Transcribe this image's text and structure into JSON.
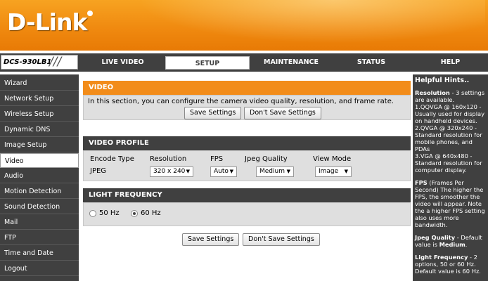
{
  "brand": {
    "logo": "D-Link",
    "model": "DCS-930LB1"
  },
  "tabs": [
    {
      "label": "LIVE VIDEO",
      "selected": false
    },
    {
      "label": "SETUP",
      "selected": true
    },
    {
      "label": "MAINTENANCE",
      "selected": false
    },
    {
      "label": "STATUS",
      "selected": false
    },
    {
      "label": "HELP",
      "selected": false
    }
  ],
  "sidebar": {
    "items": [
      {
        "label": "Wizard"
      },
      {
        "label": "Network Setup"
      },
      {
        "label": "Wireless Setup"
      },
      {
        "label": "Dynamic DNS"
      },
      {
        "label": "Image Setup"
      },
      {
        "label": "Video",
        "active": true
      },
      {
        "label": "Audio"
      },
      {
        "label": "Motion Detection"
      },
      {
        "label": "Sound Detection"
      },
      {
        "label": "Mail"
      },
      {
        "label": "FTP"
      },
      {
        "label": "Time and Date"
      },
      {
        "label": "Logout"
      }
    ]
  },
  "video": {
    "title": "VIDEO",
    "description": "In this section, you can configure the camera video quality, resolution, and frame rate.",
    "save_label": "Save Settings",
    "dont_save_label": "Don't Save Settings"
  },
  "profile": {
    "title": "VIDEO PROFILE",
    "headers": [
      "Encode Type",
      "Resolution",
      "FPS",
      "Jpeg Quality",
      "View Mode"
    ],
    "encode_type": "JPEG",
    "resolution": "320 x 240",
    "fps": "Auto",
    "jpeg_quality": "Medium",
    "view_mode": "Image"
  },
  "light": {
    "title": "LIGHT FREQUENCY",
    "opt_50": "50 Hz",
    "opt_60": "60 Hz",
    "selected": "60 Hz"
  },
  "bottom": {
    "save_label": "Save Settings",
    "dont_save_label": "Don't Save Settings"
  },
  "hints": {
    "title": "Helpful Hints..",
    "res_title": "Resolution",
    "res_text": " - 3 settings are available.",
    "res_l1": "1.QQVGA @ 160x120 - Usually used for display on handheld devices.",
    "res_l2": "2.QVGA @ 320x240 - Standard resolution for mobile phones, and PDAs",
    "res_l3": "3.VGA @ 640x480 - Standard resolution for computer display.",
    "fps_title": "FPS",
    "fps_text": " (Frames Per Second) The higher the FPS, the smoother the video will appear. Note the a higher FPS setting also uses more bandwidth.",
    "jq_title": "Jpeg Quality",
    "jq_text": " - Default value is ",
    "jq_default": "Medium",
    "lf_title": "Light Frequency",
    "lf_text": " - 2 options, 50 or 60 Hz. Default value is 60 Hz."
  }
}
